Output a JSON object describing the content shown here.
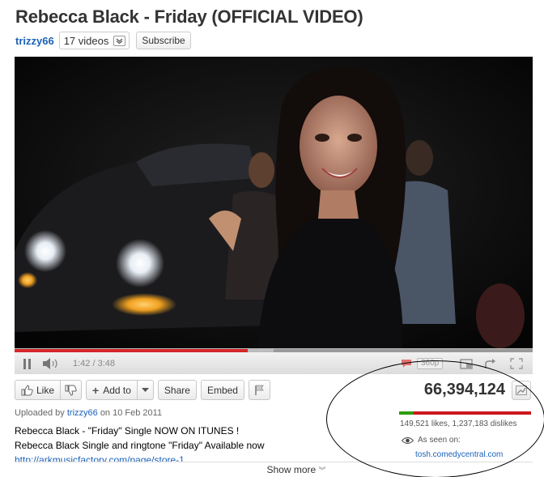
{
  "video": {
    "title": "Rebecca Black - Friday (OFFICIAL VIDEO)"
  },
  "channel": {
    "name": "trizzy66",
    "videos_label": "17 videos",
    "subscribe_label": "Subscribe"
  },
  "player": {
    "time": "1:42 / 3:48",
    "progress_fraction": 0.45,
    "buffered_fraction": 0.5,
    "quality": "360p",
    "colors": {
      "played": "#d3262b"
    }
  },
  "actions": {
    "like_label": "Like",
    "add_to_label": "Add to",
    "share_label": "Share",
    "embed_label": "Embed"
  },
  "uploader": {
    "prefix": "Uploaded by",
    "name": "trizzy66",
    "date": "on 10 Feb 2011"
  },
  "description": {
    "line1": "Rebecca Black - \"Friday\" Single NOW ON ITUNES !",
    "line2": "Rebecca Black Single and ringtone \"Friday\" Available now",
    "link": "http://arkmusicfactory.com/page/store-1",
    "show_more": "Show more"
  },
  "stats": {
    "views": "66,394,124",
    "likes_dislikes": "149,521 likes, 1,237,183 dislikes",
    "likes_fraction": 0.108,
    "as_seen_on": "As seen on:",
    "seen_link": "tosh.comedycentral.com",
    "colors": {
      "likes": "#2f9d0c",
      "dislikes": "#cc181e"
    }
  }
}
